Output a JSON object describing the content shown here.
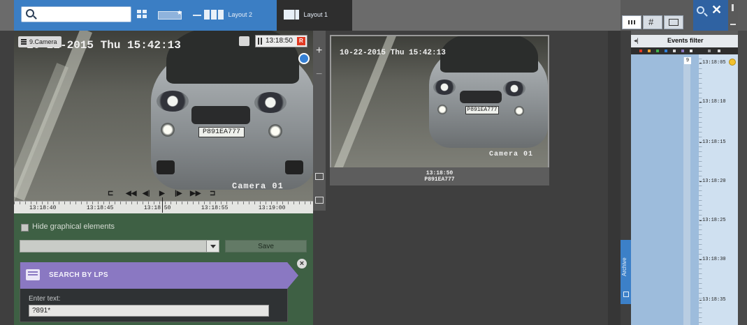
{
  "toolbar": {
    "search_placeholder": "",
    "layouts": [
      {
        "label": "Layout 2"
      },
      {
        "label": "Layout 1"
      }
    ],
    "right_buttons": [
      "grid-view",
      "hash-view",
      "single-view"
    ]
  },
  "camera1": {
    "name": "9.Camera",
    "overlay_date": "10-22-2015 Thu 15:42:13",
    "record_time": "13:18:50",
    "record_badge": "R",
    "overlay_name": "Camera 01",
    "plate": "P891EA777"
  },
  "timeline": {
    "labels": [
      "13:18:40",
      "13:18:45",
      "13:18:50",
      "13:18:55",
      "13:19:00"
    ]
  },
  "panel": {
    "hide_label": "Hide graphical elements",
    "save_label": "Save",
    "search_title": "SEARCH BY LPS",
    "enter_label": "Enter text:",
    "enter_value": "?891*",
    "close_glyph": "×"
  },
  "camera2": {
    "overlay_date": "10-22-2015 Thu 15:42:13",
    "overlay_name": "Camera 01",
    "plate": "P891EA777",
    "caption_time": "13:18:50",
    "caption_plate": "P891EA777"
  },
  "archive": {
    "label": "Archive"
  },
  "events": {
    "title": "Events filter",
    "back": "◂|",
    "counter": "9",
    "ticks": [
      "13:18:05",
      "13:18:10",
      "13:18:15",
      "13:18:20",
      "13:18:25",
      "13:18:30",
      "13:18:35"
    ]
  },
  "colors": {
    "accent": "#3b7ec4",
    "panel_green": "#3e6044",
    "lps_purple": "#8a78c2",
    "rec_red": "#e23a22"
  }
}
